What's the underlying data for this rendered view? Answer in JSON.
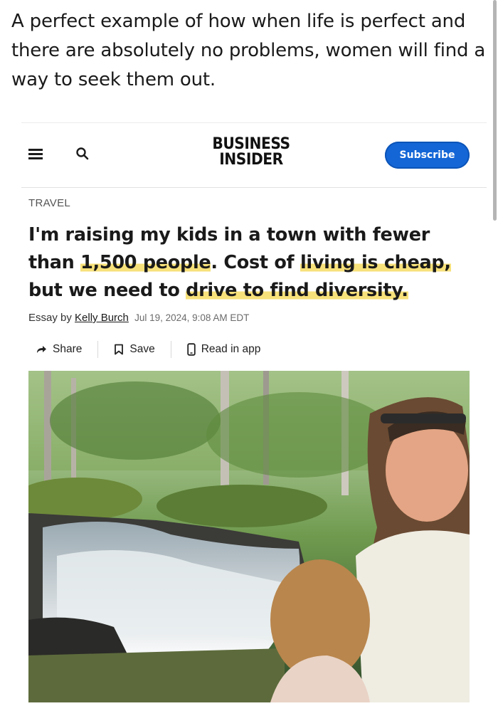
{
  "caption": "A perfect example of how when life is perfect and there are absolutely no problems, women will find a way to seek them out.",
  "header": {
    "logo_line1": "BUSINESS",
    "logo_line2": "INSIDER",
    "subscribe_label": "Subscribe",
    "menu_icon": "hamburger-menu-icon",
    "search_icon": "search-icon"
  },
  "article": {
    "category": "TRAVEL",
    "headline": {
      "part1": "I'm raising my kids in a town with fewer than ",
      "highlight1": "1,500 people",
      "part2": ". Cost of ",
      "highlight2": "living is cheap,",
      "part3": " but we need to ",
      "highlight3": "drive to find diversity."
    },
    "byline_prefix": "Essay by",
    "author": "Kelly Burch",
    "date": "Jul 19, 2024, 9:08 AM EDT",
    "highlight_color": "#f7e17a"
  },
  "actions": {
    "share_label": "Share",
    "save_label": "Save",
    "read_in_app_label": "Read in app"
  },
  "colors": {
    "subscribe_bg": "#1466d6",
    "text": "#1a1a1a"
  }
}
